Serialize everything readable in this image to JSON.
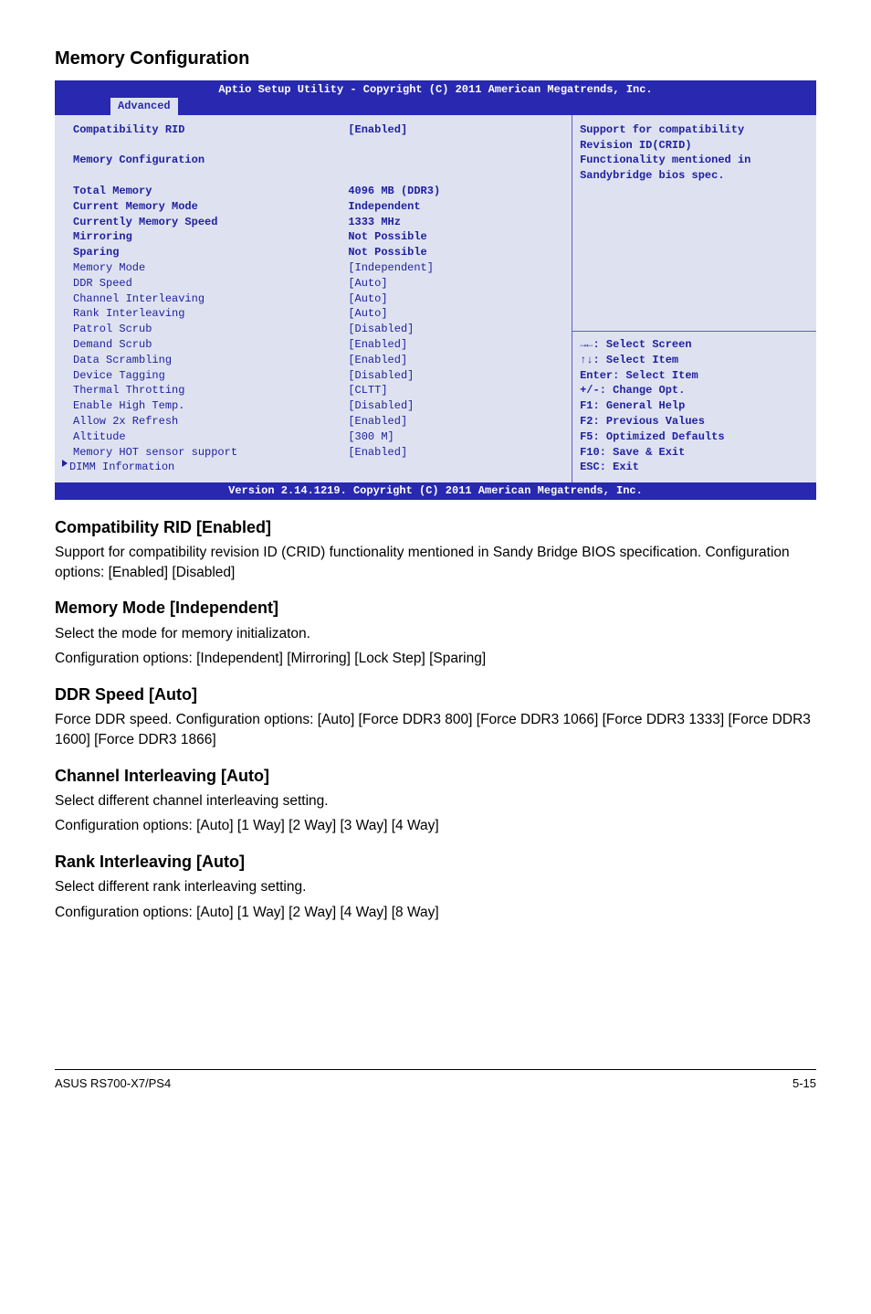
{
  "section_title": "Memory Configuration",
  "bios": {
    "header": "Aptio Setup Utility - Copyright (C) 2011 American Megatrends, Inc.",
    "tab": "Advanced",
    "left": {
      "rows": [
        {
          "k": "Compatibility RID",
          "v": "[Enabled]",
          "bold": true
        },
        {
          "k": " ",
          "v": " "
        },
        {
          "k": "Memory Configuration",
          "v": " ",
          "bold": true
        },
        {
          "k": " ",
          "v": " "
        },
        {
          "k": "Total Memory",
          "v": "4096 MB (DDR3)",
          "bold": true
        },
        {
          "k": "Current Memory Mode",
          "v": "Independent",
          "bold": true
        },
        {
          "k": "Currently Memory Speed",
          "v": "1333 MHz",
          "bold": true
        },
        {
          "k": "Mirroring",
          "v": "Not Possible",
          "bold": true
        },
        {
          "k": "Sparing",
          "v": "Not Possible",
          "bold": true
        },
        {
          "k": "Memory Mode",
          "v": "[Independent]"
        },
        {
          "k": "DDR Speed",
          "v": "[Auto]"
        },
        {
          "k": "Channel Interleaving",
          "v": "[Auto]"
        },
        {
          "k": "Rank Interleaving",
          "v": "[Auto]"
        },
        {
          "k": "Patrol Scrub",
          "v": "[Disabled]"
        },
        {
          "k": "Demand Scrub",
          "v": "[Enabled]"
        },
        {
          "k": "Data Scrambling",
          "v": "[Enabled]"
        },
        {
          "k": "Device Tagging",
          "v": "[Disabled]"
        },
        {
          "k": "Thermal Throtting",
          "v": "[CLTT]"
        },
        {
          "k": "Enable High Temp.",
          "v": "[Disabled]"
        },
        {
          "k": "Allow 2x Refresh",
          "v": "[Enabled]"
        },
        {
          "k": "Altitude",
          "v": "[300 M]"
        },
        {
          "k": "Memory HOT sensor support",
          "v": "[Enabled]"
        }
      ],
      "dimm": "DIMM Information"
    },
    "help": {
      "l1": "Support for compatibility",
      "l2": "Revision ID(CRID)",
      "l3": "Functionality mentioned in",
      "l4": "Sandybridge bios spec."
    },
    "legend": {
      "l1": "→←: Select Screen",
      "l2": "↑↓:  Select Item",
      "l3": "Enter: Select Item",
      "l4": "+/-: Change Opt.",
      "l5": "F1: General Help",
      "l6": "F2: Previous Values",
      "l7": "F5: Optimized Defaults",
      "l8": "F10: Save & Exit",
      "l9": "ESC: Exit"
    },
    "footer": "Version 2.14.1219. Copyright (C) 2011 American Megatrends, Inc."
  },
  "sub1_title": "Compatibility RID [Enabled]",
  "sub1_body": "Support for compatibility revision ID (CRID) functionality mentioned in Sandy Bridge BIOS specification. Configuration options: [Enabled] [Disabled]",
  "sub2_title": "Memory Mode [Independent]",
  "sub2_body1": "Select the mode for memory initializaton.",
  "sub2_body2": "Configuration options: [Independent] [Mirroring] [Lock Step] [Sparing]",
  "sub3_title": "DDR Speed [Auto]",
  "sub3_body": "Force DDR speed. Configuration options: [Auto] [Force DDR3 800] [Force DDR3 1066] [Force DDR3 1333] [Force DDR3 1600] [Force DDR3 1866]",
  "sub4_title": "Channel Interleaving [Auto]",
  "sub4_body1": "Select different channel interleaving setting.",
  "sub4_body2": "Configuration options: [Auto] [1 Way] [2 Way] [3 Way] [4 Way]",
  "sub5_title": "Rank Interleaving [Auto]",
  "sub5_body1": "Select different rank interleaving setting.",
  "sub5_body2": "Configuration options: [Auto] [1 Way] [2 Way] [4 Way] [8 Way]",
  "footer_left": "ASUS RS700-X7/PS4",
  "footer_right": "5-15"
}
